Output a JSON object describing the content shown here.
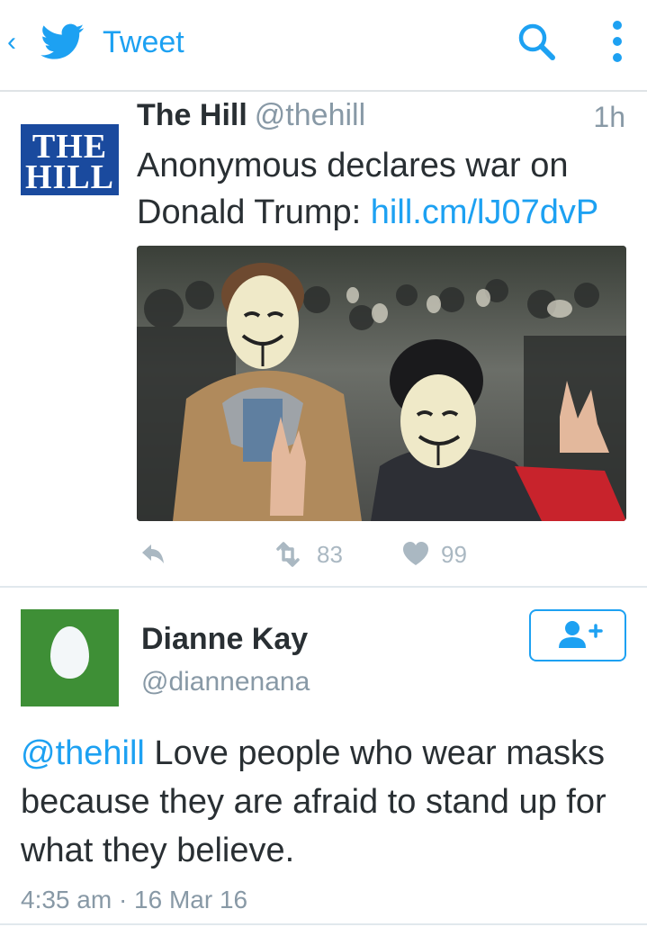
{
  "header": {
    "title": "Tweet",
    "back_icon": "back-chevron-icon",
    "logo_icon": "twitter-bird-icon",
    "search_icon": "search-icon",
    "menu_icon": "more-vertical-icon",
    "accent": "#1da1f2"
  },
  "tweet": {
    "avatar_text_1": "THE",
    "avatar_text_2": "HILL",
    "author_name": "The Hill",
    "author_handle": "@thehill",
    "time": "1h",
    "text_prefix": "Anonymous declares war on Donald Trump: ",
    "link": "hill.cm/lJ07dvP",
    "retweets": "83",
    "likes": "99"
  },
  "reply": {
    "author_name": "Dianne Kay",
    "author_handle": "@diannenana",
    "mention": "@thehill",
    "text": " Love people who wear masks because they are afraid to stand up for what they believe.",
    "timestamp": "4:35 am · 16 Mar 16",
    "follow_icon": "follow-user-icon"
  }
}
